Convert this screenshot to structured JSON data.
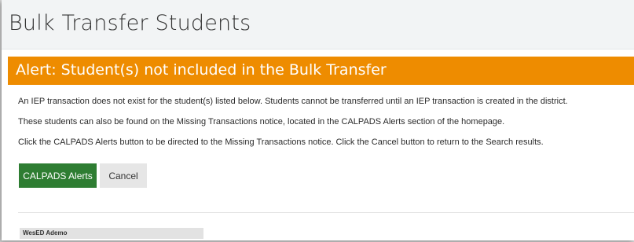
{
  "page": {
    "title": "Bulk Transfer Students"
  },
  "alert": {
    "title": "Alert: Student(s) not included in the Bulk Transfer",
    "messages": [
      "An IEP transaction does not exist for the student(s) listed below. Students cannot be transferred until an IEP transaction is created in the district.",
      "These students can also be found on the Missing Transactions notice, located in the CALPADS Alerts section of the homepage.",
      "Click the CALPADS Alerts button to be directed to the Missing Transactions notice. Click the Cancel button to return to the Search results."
    ],
    "buttons": {
      "primary_label": "CALPADS Alerts",
      "secondary_label": "Cancel"
    }
  },
  "list": {
    "organization_label": "WesED Ademo"
  },
  "colors": {
    "alert_header": "#ee8c00",
    "primary_button": "#2e7d32",
    "secondary_button": "#e6e6e6",
    "title_bar": "#f2f4f5"
  }
}
